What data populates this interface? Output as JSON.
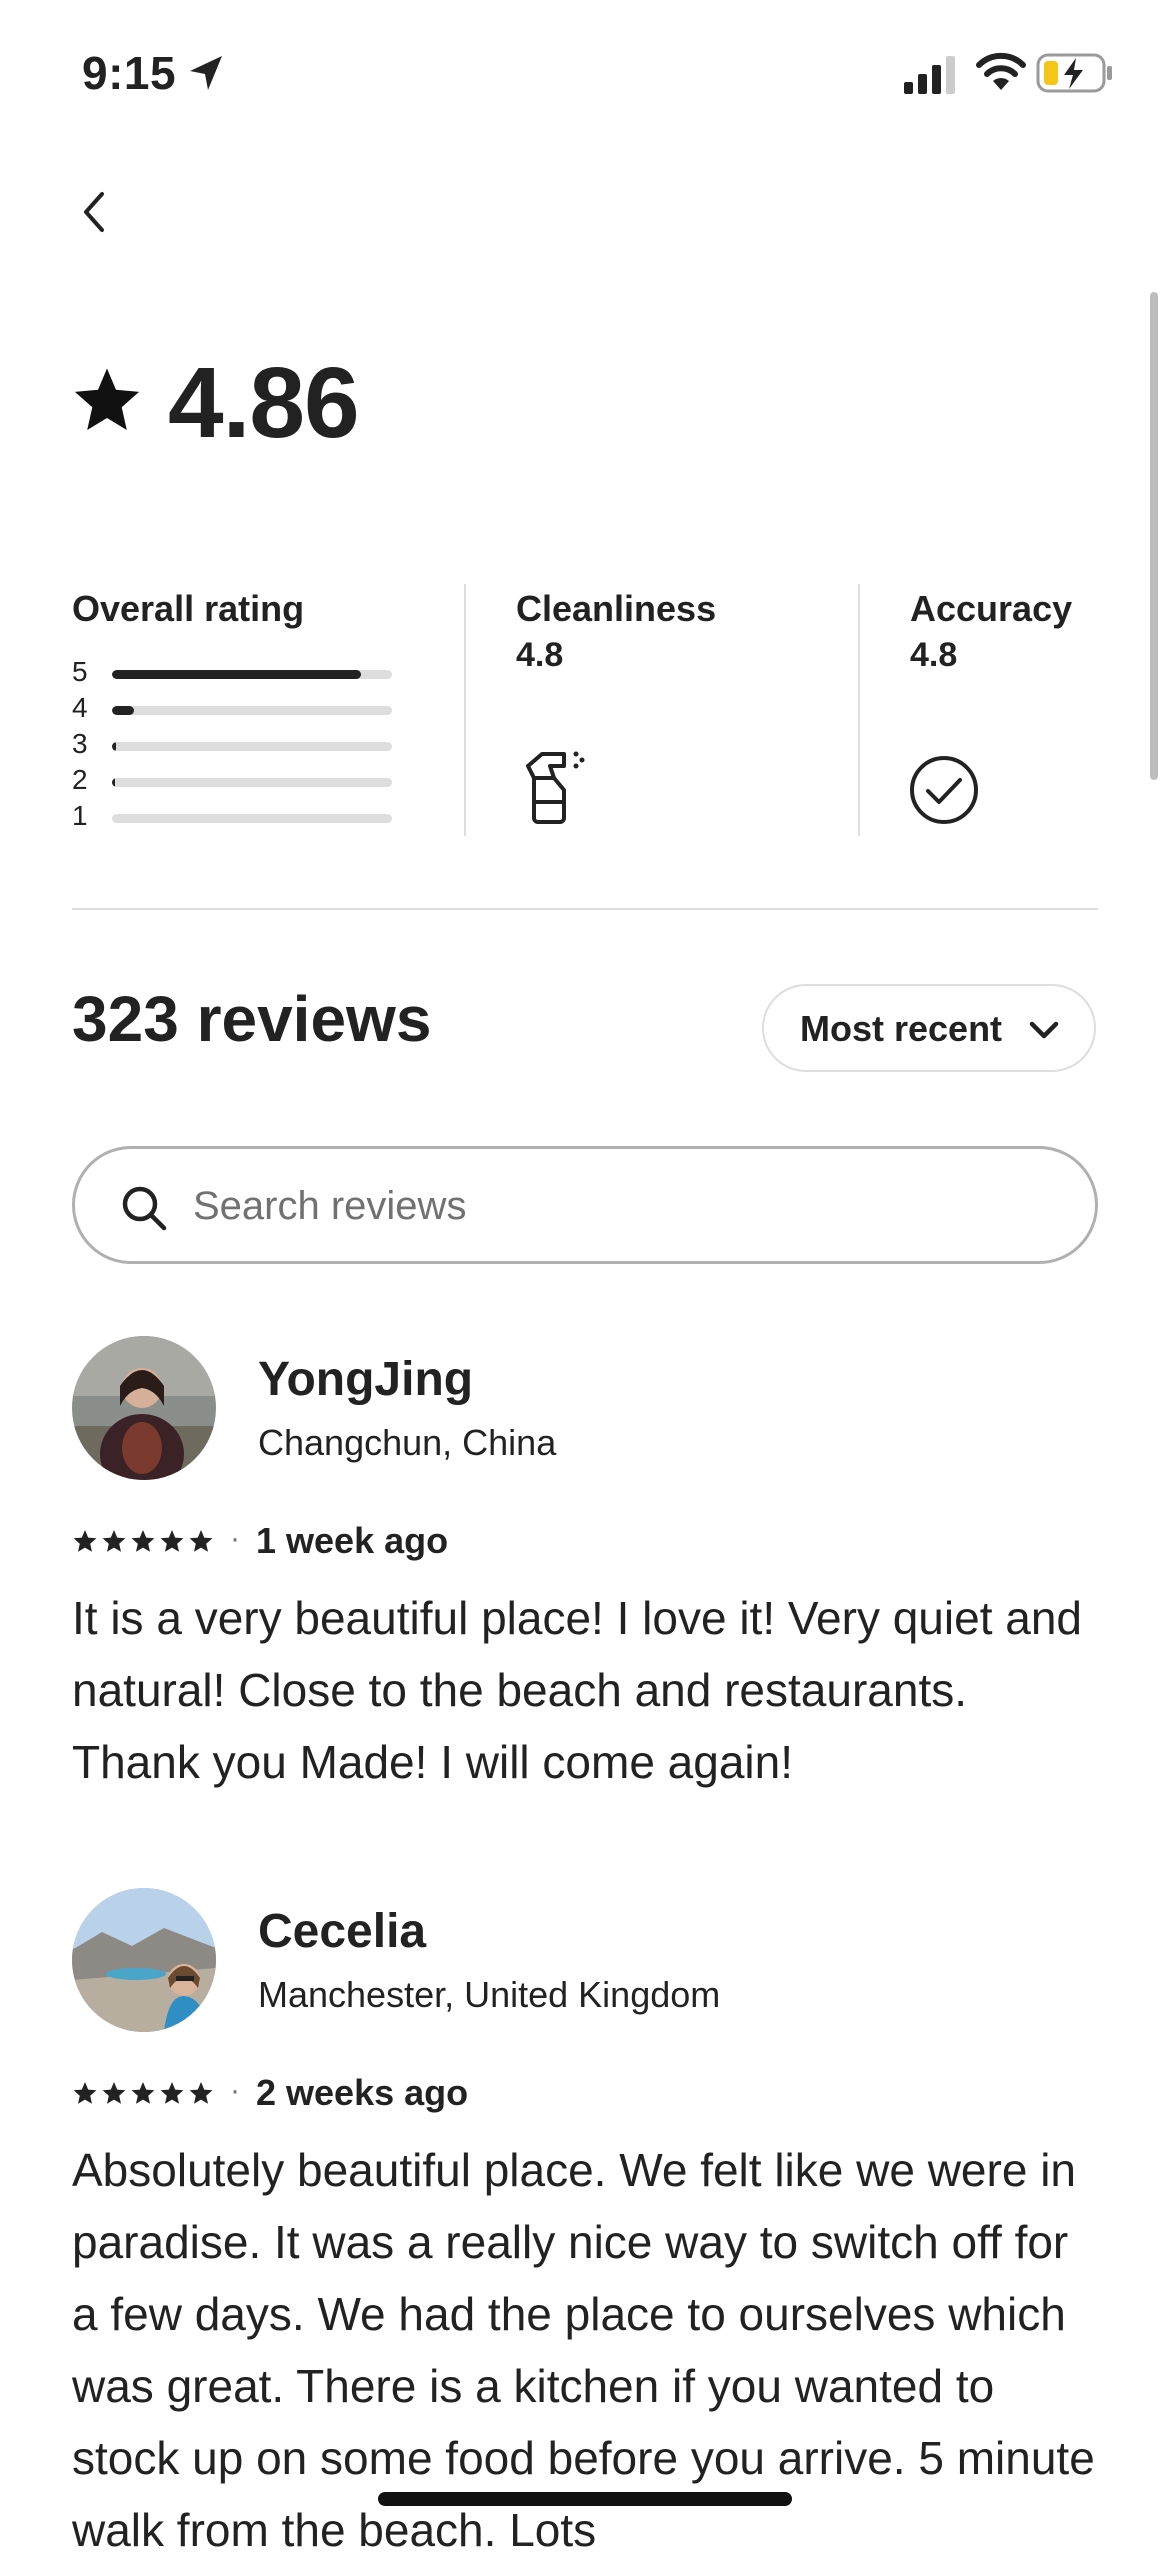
{
  "status_bar": {
    "time": "9:15"
  },
  "rating": {
    "value": "4.86"
  },
  "overall": {
    "title": "Overall rating",
    "rows": [
      {
        "label": "5",
        "fraction": 0.89
      },
      {
        "label": "4",
        "fraction": 0.08
      },
      {
        "label": "3",
        "fraction": 0.015
      },
      {
        "label": "2",
        "fraction": 0.005
      },
      {
        "label": "1",
        "fraction": 0.0
      }
    ]
  },
  "categories": [
    {
      "title": "Cleanliness",
      "value": "4.8",
      "icon": "spray-bottle-icon"
    },
    {
      "title": "Accuracy",
      "value": "4.8",
      "icon": "check-circle-icon"
    }
  ],
  "reviews_header": {
    "count_label": "323 reviews",
    "sort_label": "Most recent"
  },
  "search": {
    "placeholder": "Search reviews"
  },
  "reviews": [
    {
      "name": "YongJing",
      "location": "Changchun, China",
      "date": "1 week ago",
      "text": "It is a very beautiful place! I love it! Very quiet and natural! Close to the beach and restaurants. Thank you Made! I will come again!"
    },
    {
      "name": "Cecelia",
      "location": "Manchester, United Kingdom",
      "date": "2 weeks ago",
      "text": "Absolutely beautiful place. We felt like we were in paradise. It was a really nice way to switch off for a few days. We had the place to ourselves which was great. There is a kitchen if you wanted to stock up on some food before you arrive. 5 minute walk from the beach. Lots"
    }
  ],
  "meta_separator": "·"
}
